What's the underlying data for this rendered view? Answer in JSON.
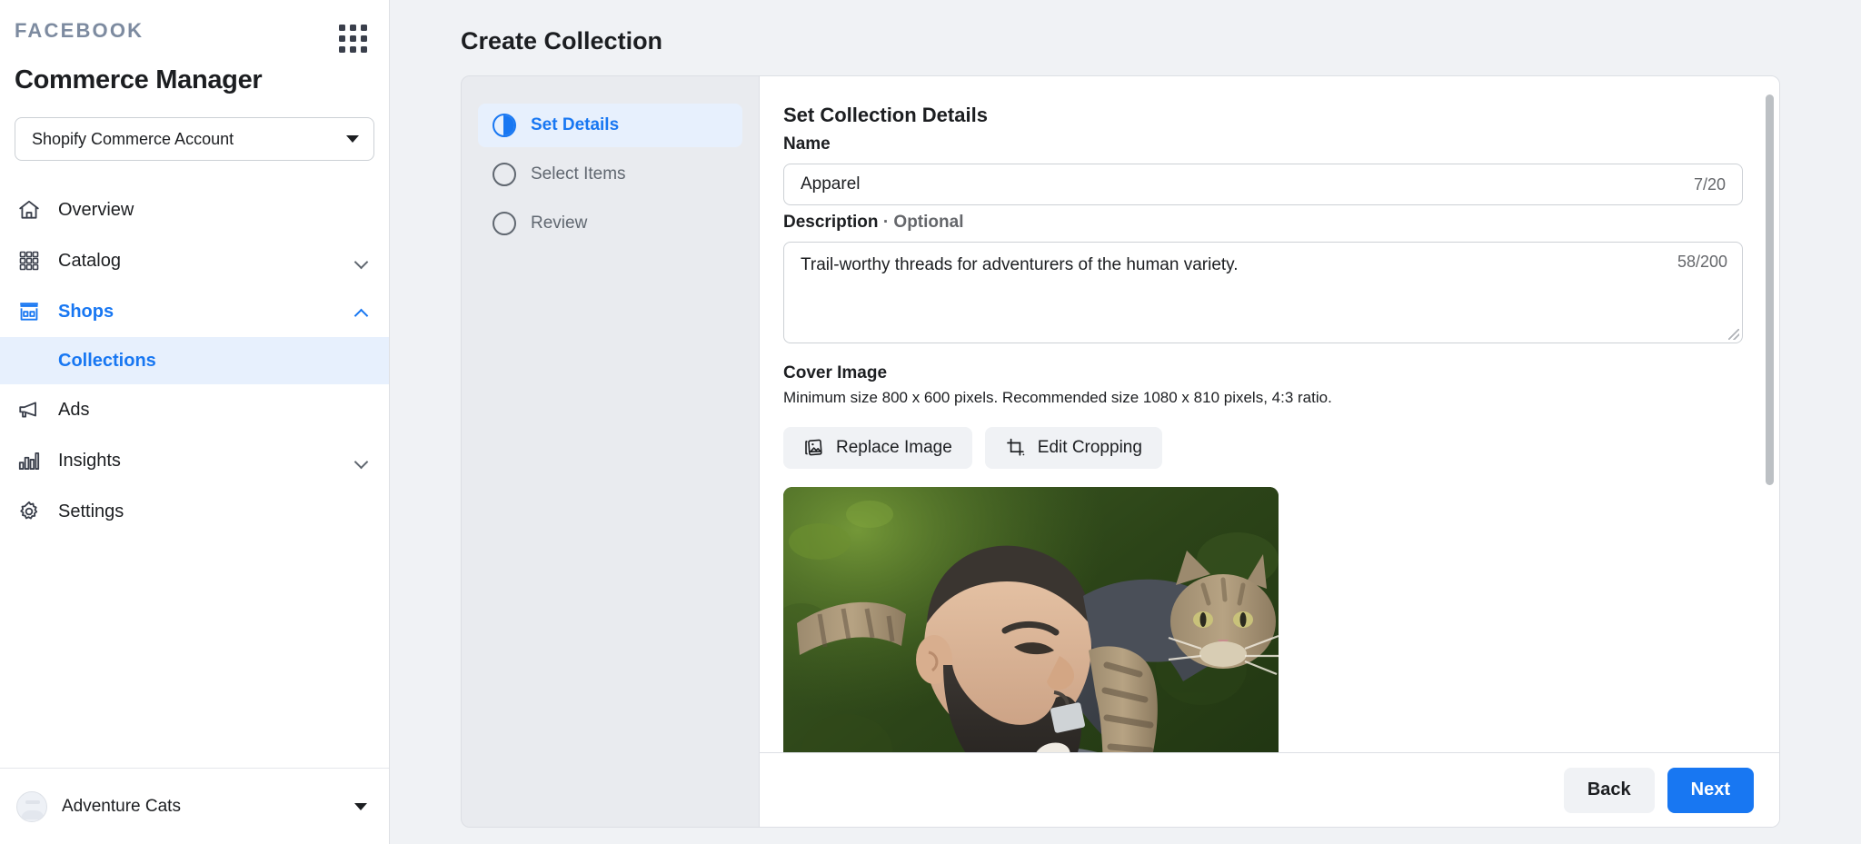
{
  "sidebar": {
    "brand_wordmark": "FACEBOOK",
    "apps_icon": "grid-apps-icon",
    "app_title": "Commerce Manager",
    "account": {
      "value": "Shopify Commerce Account",
      "icon": "chevron-down-icon"
    },
    "nav": [
      {
        "label": "Overview",
        "icon": "home-icon",
        "expandable": false,
        "active": false
      },
      {
        "label": "Catalog",
        "icon": "catalog-grid-icon",
        "expandable": true,
        "active": false
      },
      {
        "label": "Shops",
        "icon": "shop-storefront-icon",
        "expandable": true,
        "active": true
      },
      {
        "label": "Ads",
        "icon": "megaphone-icon",
        "expandable": false,
        "active": false
      },
      {
        "label": "Insights",
        "icon": "bar-chart-icon",
        "expandable": true,
        "active": false
      },
      {
        "label": "Settings",
        "icon": "gear-icon",
        "expandable": false,
        "active": false
      }
    ],
    "sub_item": {
      "label": "Collections",
      "active": true
    },
    "footer": {
      "name": "Adventure Cats",
      "avatar": "user-avatar",
      "icon": "chevron-down-icon"
    }
  },
  "main": {
    "page_title": "Create Collection",
    "steps": [
      {
        "label": "Set Details",
        "state": "active",
        "icon": "half-filled-circle-icon"
      },
      {
        "label": "Select Items",
        "state": "pending",
        "icon": "empty-circle-icon"
      },
      {
        "label": "Review",
        "state": "pending",
        "icon": "empty-circle-icon"
      }
    ],
    "form": {
      "section_title": "Set Collection Details",
      "name_label": "Name",
      "name_value": "Apparel",
      "name_placeholder": "Name",
      "name_counter": "7/20",
      "description_label": "Description",
      "description_optional": "· Optional",
      "description_value": "Trail-worthy threads for adventurers of the human variety.",
      "description_placeholder": "Description",
      "description_counter": "58/200",
      "cover_image_label": "Cover Image",
      "cover_image_help": "Minimum size 800 x 600 pixels. Recommended size 1080 x 810 pixels, 4:3 ratio.",
      "replace_image_button": "Replace Image",
      "replace_image_icon": "photos-stack-icon",
      "edit_cropping_button": "Edit Cropping",
      "edit_cropping_icon": "crop-icon",
      "cover_image_alt": "Bearded man with a tabby cat on his shoulder outdoors"
    },
    "footer": {
      "back_label": "Back",
      "next_label": "Next"
    }
  },
  "colors": {
    "accent": "#1877f2",
    "accent_soft": "#e7f0fd",
    "surface": "#ffffff",
    "canvas": "#f0f2f5",
    "panel_gray": "#e9ebef",
    "text": "#1c1e21",
    "text_muted": "#65676b",
    "border": "#ccd0d5",
    "brand_wordmark": "#7d8ba0"
  }
}
